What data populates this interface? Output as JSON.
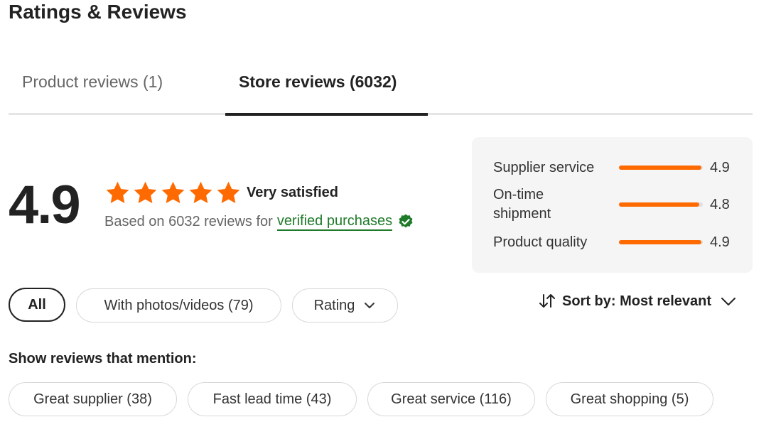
{
  "page": {
    "title": "Ratings & Reviews"
  },
  "tabs": [
    {
      "label": "Product reviews (1)",
      "active": false
    },
    {
      "label": "Store reviews (6032)",
      "active": true
    }
  ],
  "summary": {
    "score": "4.9",
    "stars": 5,
    "satisfaction": "Very satisfied",
    "based_on": "Based on 6032 reviews for",
    "verified_link": "verified purchases"
  },
  "scores": [
    {
      "label": "Supplier service",
      "value": "4.9",
      "fraction": 0.98
    },
    {
      "label": "On-time\nshipment",
      "value": "4.8",
      "fraction": 0.96
    },
    {
      "label": "Product quality",
      "value": "4.9",
      "fraction": 0.98
    }
  ],
  "filters": [
    {
      "label": "All",
      "selected": true
    },
    {
      "label": "With photos/videos (79)",
      "selected": false
    },
    {
      "label": "Rating",
      "selected": false,
      "dropdown": true
    }
  ],
  "sort": {
    "label": "Sort by: Most relevant"
  },
  "mentions": {
    "heading": "Show reviews that mention:",
    "tags": [
      "Great supplier (38)",
      "Fast lead time (43)",
      "Great service (116)",
      "Great shopping (5)"
    ]
  },
  "colors": {
    "accent": "#ff6a00",
    "verified": "#1f7a29",
    "text": "#222222",
    "muted": "#666666"
  },
  "icons": {
    "star": "star-icon",
    "verified": "verified-badge-icon",
    "sort": "sort-arrows-icon",
    "chevron": "chevron-down-icon"
  }
}
